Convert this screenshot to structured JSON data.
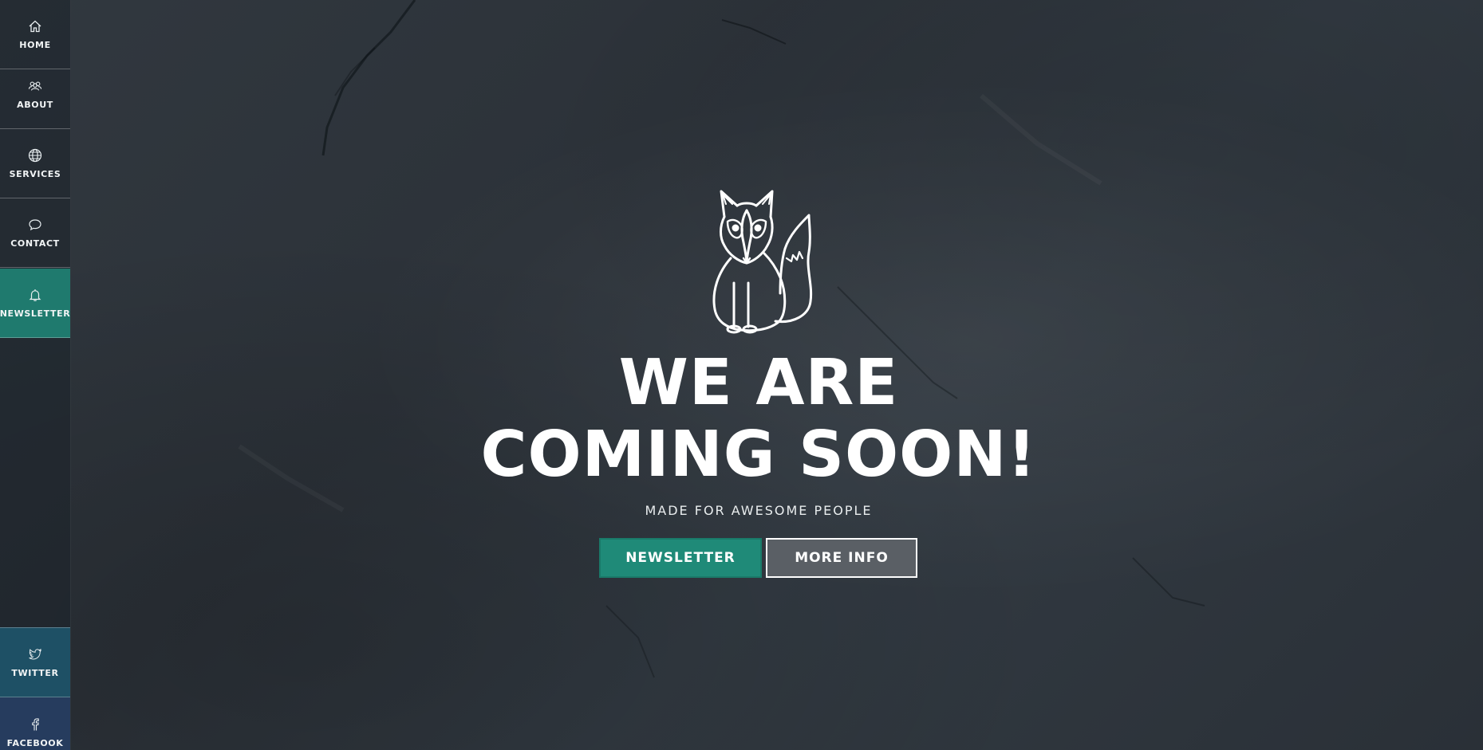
{
  "sidebar": {
    "items": [
      {
        "label": "HOME",
        "icon": "home-icon"
      },
      {
        "label": "ABOUT",
        "icon": "people-icon"
      },
      {
        "label": "SERVICES",
        "icon": "globe-icon"
      },
      {
        "label": "CONTACT",
        "icon": "speech-bubble-icon"
      },
      {
        "label": "NEWSLETTER",
        "icon": "bell-icon",
        "active": true
      }
    ],
    "social": [
      {
        "label": "TWITTER",
        "icon": "twitter-icon"
      },
      {
        "label": "FACEBOOK",
        "icon": "facebook-icon"
      }
    ]
  },
  "hero": {
    "logo": "fox-logo",
    "headline_line1": "WE ARE",
    "headline_line2": "COMING SOON!",
    "tagline": "MADE FOR AWESOME PEOPLE",
    "newsletter_button": "NEWSLETTER",
    "more_info_button": "MORE INFO"
  },
  "colors": {
    "background": "#2f353c",
    "accent_teal": "#1f8a78",
    "twitter_bg": "#1e5065",
    "facebook_bg": "#263c5e",
    "more_info_bg": "#5a5f65",
    "text": "#ffffff"
  }
}
